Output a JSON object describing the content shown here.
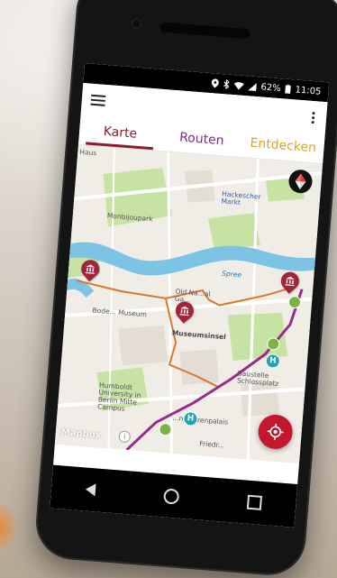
{
  "status": {
    "battery": "62%",
    "time": "11:05"
  },
  "tabs": {
    "karte": "Karte",
    "routen": "Routen",
    "entdecken": "Entdecken"
  },
  "map": {
    "labels": {
      "haus": "Haus",
      "hackescher": "Hackescher\nMarkt",
      "monbijoupark": "Monbijoupark",
      "spree": "Spree",
      "old_national": "Old Na...al\nGa...",
      "bode_museum": "Bode... Museum",
      "museumsinsel": "Museumsinsel",
      "baustelle": "Baustelle\nSchlossplatz",
      "humboldt": "Humboldt\nUniversity in\nBerlin Mitte\nCampus",
      "kronprinzen": "...nprinzenpalais",
      "friedr": "Friedr..."
    },
    "attribution": "Mapbox",
    "info": "i"
  },
  "colors": {
    "accent_red": "#c3172e",
    "route_orange": "#d9772c",
    "route_purple": "#9c2a8c",
    "water": "#7cc3e4",
    "park": "#c6e3a3"
  },
  "icons": {
    "menu": "menu-icon",
    "overflow": "more-vert-icon",
    "compass": "compass-icon",
    "locate": "locate-icon",
    "museum_pin": "museum-pin-icon",
    "transit": "transit-h-icon",
    "walk": "walk-icon",
    "nav_back": "back-icon",
    "nav_home": "home-icon",
    "nav_recent": "recent-apps-icon"
  }
}
